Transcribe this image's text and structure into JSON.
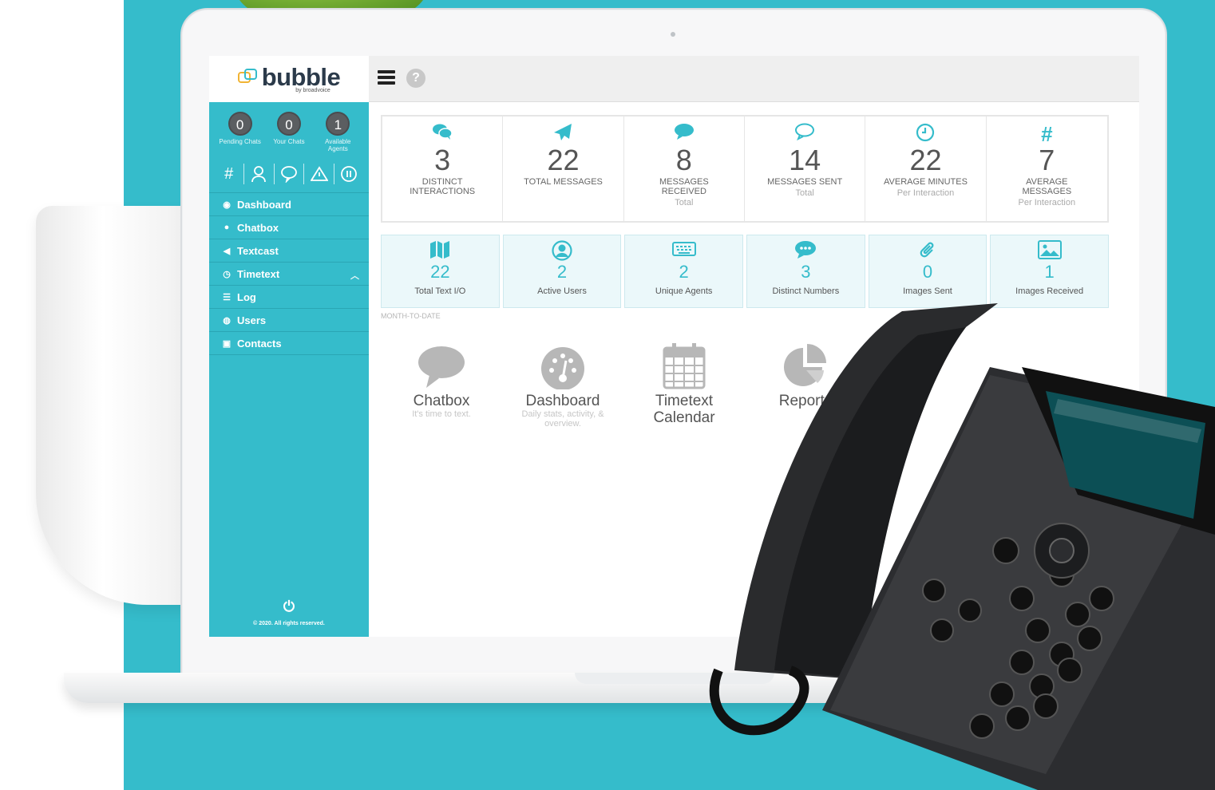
{
  "colors": {
    "brand_teal": "#35bccb",
    "counter_gray": "#5b5e61",
    "logo_yellow": "#f1b434"
  },
  "brand": {
    "name": "bubble",
    "tagline": "by broadvoice"
  },
  "header": {
    "menu_icon": "hamburger-icon",
    "help_icon": "question-icon"
  },
  "sidebar": {
    "counters": [
      {
        "value": "0",
        "label": "Pending Chats"
      },
      {
        "value": "0",
        "label": "Your Chats"
      },
      {
        "value": "1",
        "label": "Available Agents"
      }
    ],
    "quick_icons": [
      "hash-icon",
      "user-icon",
      "chat-bubble-icon",
      "warning-icon",
      "pause-icon"
    ],
    "menu": [
      {
        "label": "Dashboard",
        "icon": "dashboard-icon"
      },
      {
        "label": "Chatbox",
        "icon": "chat-icon"
      },
      {
        "label": "Textcast",
        "icon": "megaphone-icon"
      },
      {
        "label": "Timetext",
        "icon": "clock-icon",
        "expanded": true
      },
      {
        "label": "Log",
        "icon": "list-icon"
      },
      {
        "label": "Users",
        "icon": "user-circle-icon"
      },
      {
        "label": "Contacts",
        "icon": "contact-card-icon"
      }
    ],
    "footer": {
      "power_icon": "power-icon",
      "copyright": "© 2020. All rights reserved."
    }
  },
  "stats": [
    {
      "icon": "chat-bubbles-icon",
      "value": "3",
      "label": "DISTINCT INTERACTIONS",
      "sub": ""
    },
    {
      "icon": "paper-plane-icon",
      "value": "22",
      "label": "TOTAL MESSAGES",
      "sub": ""
    },
    {
      "icon": "chat-bubble-icon",
      "value": "8",
      "label": "MESSAGES RECEIVED",
      "sub": "Total"
    },
    {
      "icon": "chat-outline-icon",
      "value": "14",
      "label": "MESSAGES SENT",
      "sub": "Total"
    },
    {
      "icon": "clock-icon",
      "value": "22",
      "label": "AVERAGE MINUTES",
      "sub": "Per Interaction"
    },
    {
      "icon": "hash-icon",
      "value": "7",
      "label": "AVERAGE MESSAGES",
      "sub": "Per Interaction"
    }
  ],
  "month_to_date": {
    "caption": "MONTH-TO-DATE",
    "items": [
      {
        "icon": "map-icon",
        "value": "22",
        "label": "Total Text I/O"
      },
      {
        "icon": "user-circle-icon",
        "value": "2",
        "label": "Active Users"
      },
      {
        "icon": "keyboard-icon",
        "value": "2",
        "label": "Unique Agents"
      },
      {
        "icon": "chat-dots-icon",
        "value": "3",
        "label": "Distinct Numbers"
      },
      {
        "icon": "paperclip-icon",
        "value": "0",
        "label": "Images Sent"
      },
      {
        "icon": "image-icon",
        "value": "1",
        "label": "Images Received"
      }
    ]
  },
  "shortcuts": [
    {
      "icon": "chat-bubble-icon",
      "title": "Chatbox",
      "sub": "It's time to text."
    },
    {
      "icon": "dashboard-gauge-icon",
      "title": "Dashboard",
      "sub": "Daily stats, activity, & overview."
    },
    {
      "icon": "calendar-icon",
      "title": "Timetext Calendar",
      "sub": ""
    },
    {
      "icon": "pie-chart-icon",
      "title": "Reports",
      "sub": ""
    }
  ]
}
